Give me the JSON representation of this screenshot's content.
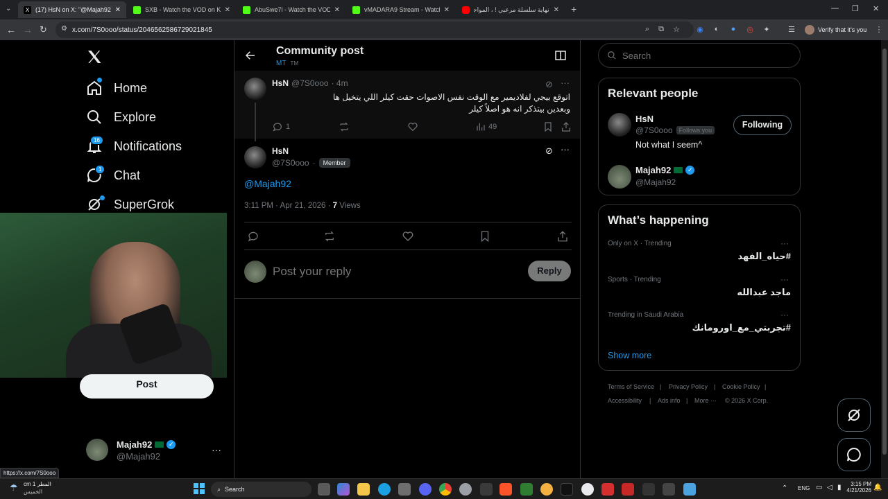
{
  "browser": {
    "tabs": [
      {
        "title": "(17) HsN on X: \"@Majah92\" / X",
        "fav": "x-icon",
        "color": "#000000"
      },
      {
        "title": "SXB - Watch the VOD on Kick",
        "fav": "kick-icon",
        "color": "#53fc18"
      },
      {
        "title": "AbuSwe7l - Watch the VOD on",
        "fav": "kick-icon",
        "color": "#53fc18"
      },
      {
        "title": "vMADARA9 Stream - Watch Liv",
        "fav": "kick-icon",
        "color": "#53fc18"
      },
      {
        "title": "نهاية سلسلة مرعبي ! ، المواجهة ال",
        "fav": "youtube-icon",
        "color": "#ff0000"
      }
    ],
    "url": "x.com/7S0ooo/status/2046562586729021845",
    "profile_label": "Verify that it's you",
    "status_url": "https://x.com/7S0ooo"
  },
  "nav": {
    "items": [
      {
        "label": "Home",
        "icon": "home-icon"
      },
      {
        "label": "Explore",
        "icon": "search-icon"
      },
      {
        "label": "Notifications",
        "icon": "bell-icon",
        "badge": "16"
      },
      {
        "label": "Chat",
        "icon": "chat-icon",
        "badge": "1"
      },
      {
        "label": "SuperGrok",
        "icon": "grok-icon"
      }
    ],
    "post_label": "Post",
    "account": {
      "name": "Majah92",
      "handle": "@Majah92"
    }
  },
  "header": {
    "title": "Community post",
    "community": "MT",
    "community_tag": "TM"
  },
  "parent_post": {
    "name": "HsN",
    "handle": "@7S0ooo",
    "time": "· 4m",
    "text_line1": "اتوقع بيجي لفلاديمير مع الوقت نفس الاصوات حقت كيلر اللي يتخيل ها",
    "text_line2": "وبعدين بيتذكر انه هو اصلاً كيلر",
    "replies": "1",
    "views": "49"
  },
  "main_post": {
    "name": "HsN",
    "handle": "@7S0ooo",
    "dot": "·",
    "member_badge": "Member",
    "mention": "@Majah92",
    "timestamp": "3:11 PM · Apr 21, 2026 · ",
    "views_count": "7",
    "views_label": "Views"
  },
  "reply": {
    "placeholder": "Post your reply",
    "button": "Reply"
  },
  "search": {
    "placeholder": "Search"
  },
  "relevant": {
    "title": "Relevant people",
    "people": [
      {
        "name": "HsN",
        "handle": "@7S0ooo",
        "follows_you": "Follows you",
        "bio": "Not what I seem^",
        "button": "Following"
      },
      {
        "name": "Majah92",
        "handle": "@Majah92"
      }
    ]
  },
  "trending": {
    "title": "What’s happening",
    "items": [
      {
        "context": "Only on X · Trending",
        "topic": "#حياه_الفهد"
      },
      {
        "context": "Sports · Trending",
        "topic": "ماجد عبدالله"
      },
      {
        "context": "Trending in Saudi Arabia",
        "topic": "#تجربتي_مع_اورومانك"
      }
    ],
    "show_more": "Show more"
  },
  "footer": {
    "links": [
      "Terms of Service",
      "Privacy Policy",
      "Cookie Policy",
      "Accessibility",
      "Ads info",
      "More ···"
    ],
    "copyright": "© 2026 X Corp."
  },
  "taskbar": {
    "weather_temp": "1 cm",
    "weather_label": "المطر",
    "weather_day": "الخميس",
    "search": "Search",
    "lang": "ENG",
    "time": "3:15 PM",
    "date": "4/21/2026"
  },
  "colors": {
    "accent": "#1d9bf0",
    "verified": "#1d9bf0"
  }
}
